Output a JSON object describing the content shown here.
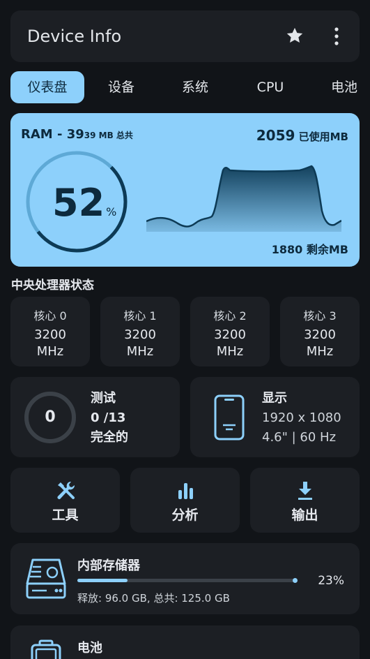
{
  "app": {
    "title": "Device Info"
  },
  "tabs": [
    {
      "label": "仪表盘"
    },
    {
      "label": "设备"
    },
    {
      "label": "系统"
    },
    {
      "label": "CPU"
    },
    {
      "label": "电池"
    }
  ],
  "ram": {
    "title_main": "RAM - 39",
    "title_small": "39 MB 总共",
    "used_value": "2059",
    "used_unit": " 已使用MB",
    "free_value": "1880",
    "free_unit": " 剩余MB",
    "percent_value": "52",
    "percent_sign": "%",
    "percent": 52
  },
  "cpu_section": {
    "title": "中央处理器状态",
    "cores": [
      {
        "label": "核心 0",
        "freq": "3200",
        "unit": "MHz"
      },
      {
        "label": "核心 1",
        "freq": "3200",
        "unit": "MHz"
      },
      {
        "label": "核心 2",
        "freq": "3200",
        "unit": "MHz"
      },
      {
        "label": "核心 3",
        "freq": "3200",
        "unit": "MHz"
      }
    ]
  },
  "tests": {
    "count": "0",
    "title": "测试",
    "progress": "0 /13",
    "status": "完全的"
  },
  "display": {
    "title": "显示",
    "resolution": "1920 x 1080",
    "details": "4.6\" | 60 Hz"
  },
  "actions": [
    {
      "label": "工具",
      "icon": "tools-icon"
    },
    {
      "label": "分析",
      "icon": "bar-chart-icon"
    },
    {
      "label": "输出",
      "icon": "download-icon"
    }
  ],
  "storage": {
    "title": "内部存储器",
    "percent_text": "23%",
    "percent": 23,
    "details": "释放: 96.0 GB,  总共: 125.0 GB"
  },
  "battery": {
    "title": "电池"
  },
  "colors": {
    "accent": "#8dd0fb",
    "background": "#111418",
    "card": "#1c1f24",
    "ram_text": "#0d2a3d"
  }
}
